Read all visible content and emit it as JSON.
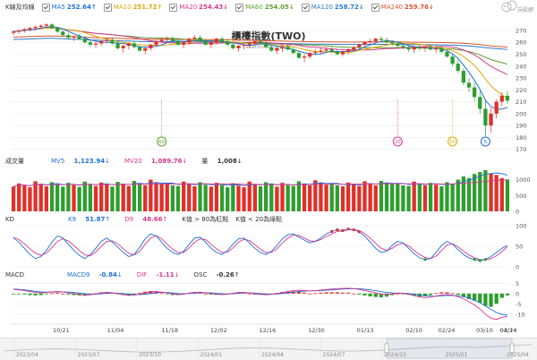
{
  "header": {
    "kline_label": "K線及均線",
    "ma": [
      {
        "name": "MA5",
        "value": "252.64",
        "arrow": "↑",
        "color": "#1e6fd9"
      },
      {
        "name": "MA10",
        "value": "251.72",
        "arrow": "↑",
        "color": "#e0a800"
      },
      {
        "name": "MA20",
        "value": "254.43",
        "arrow": "↓",
        "color": "#d9368b"
      },
      {
        "name": "MA60",
        "value": "254.05",
        "arrow": "↓",
        "color": "#5aa02c"
      },
      {
        "name": "MA120",
        "value": "258.72",
        "arrow": "↓",
        "color": "#2a7ac7"
      },
      {
        "name": "MA240",
        "value": "259.76",
        "arrow": "↓",
        "color": "#d9542b"
      }
    ],
    "logo_text": "玩股網"
  },
  "chart_title": "櫃檯指數(TWO)",
  "watermark": "WantGoo 玩股網",
  "price_axis": {
    "ticks": [
      170,
      180,
      190,
      200,
      210,
      220,
      230,
      240,
      250,
      260,
      270
    ],
    "min": 166,
    "max": 276
  },
  "volume_legend": {
    "label": "成交量",
    "mv5_name": "MV5",
    "mv5": "1,123.94",
    "mv5_arrow": "↓",
    "mv20_name": "MV20",
    "mv20": "1,089.76",
    "mv20_arrow": "↓",
    "qty_name": "量",
    "qty": "1,008",
    "qty_arrow": "↓"
  },
  "volume_axis": {
    "ticks": [
      0,
      500,
      1000
    ],
    "min": 0,
    "max": 1300
  },
  "kd_legend": {
    "label": "KD",
    "k_name": "K9",
    "k": "51.87",
    "k_arrow": "↑",
    "d_name": "D9",
    "d": "48.66",
    "d_arrow": "↑",
    "rule1": "K值 > 80為紅點",
    "rule2": "K值 < 20為綠點"
  },
  "kd_axis": {
    "ticks": [
      0,
      50,
      100
    ],
    "min": 0,
    "max": 100
  },
  "macd_legend": {
    "label": "MACD",
    "macd_name": "MACD9",
    "macd": "-0.84",
    "macd_arrow": "↓",
    "dif_name": "DIF",
    "dif": "-1.11",
    "dif_arrow": "↓",
    "osc_name": "OSC",
    "osc": "-0.26",
    "osc_arrow": "↑"
  },
  "macd_axis": {
    "ticks": [
      5,
      0,
      -5,
      -10
    ]
  },
  "x_dates": [
    "10/21",
    "11/04",
    "11/18",
    "12/02",
    "12/16",
    "12/30",
    "01/13",
    "02/10",
    "02/24",
    "03/10",
    "03/24",
    "04/14"
  ],
  "markers": [
    {
      "label": "60",
      "color": "#5aa02c",
      "after_date": "01/13"
    },
    {
      "label": "20",
      "color": "#d9368b",
      "after_date": "03/24"
    },
    {
      "label": "10",
      "color": "#e0a800",
      "after_date": "03/24"
    },
    {
      "label": "5",
      "color": "#1e6fd9",
      "after_date": "03/24"
    }
  ],
  "navigator_dates": [
    "2023/04",
    "2023/07",
    "2023/10",
    "2024/01",
    "2024/04",
    "2024/07",
    "2024/10",
    "2025/01",
    "2025/04"
  ],
  "chart_data": {
    "type": "candlestick",
    "ohlc": [
      [
        268,
        270,
        266,
        269
      ],
      [
        269,
        271,
        267,
        270
      ],
      [
        270,
        272,
        268,
        271
      ],
      [
        271,
        273,
        269,
        272
      ],
      [
        272,
        274,
        270,
        273
      ],
      [
        273,
        275,
        271,
        274
      ],
      [
        274,
        276,
        272,
        275
      ],
      [
        275,
        276,
        271,
        272
      ],
      [
        272,
        273,
        268,
        269
      ],
      [
        269,
        270,
        265,
        266
      ],
      [
        266,
        268,
        262,
        264
      ],
      [
        264,
        266,
        261,
        265
      ],
      [
        265,
        267,
        262,
        263
      ],
      [
        263,
        265,
        259,
        260
      ],
      [
        260,
        262,
        256,
        258
      ],
      [
        258,
        261,
        255,
        259
      ],
      [
        259,
        262,
        257,
        261
      ],
      [
        261,
        264,
        259,
        262
      ],
      [
        262,
        264,
        258,
        259
      ],
      [
        259,
        261,
        254,
        255
      ],
      [
        255,
        258,
        251,
        257
      ],
      [
        257,
        260,
        254,
        259
      ],
      [
        259,
        261,
        255,
        256
      ],
      [
        256,
        258,
        252,
        253
      ],
      [
        253,
        256,
        250,
        255
      ],
      [
        255,
        259,
        253,
        258
      ],
      [
        258,
        262,
        256,
        261
      ],
      [
        261,
        264,
        259,
        262
      ],
      [
        262,
        265,
        260,
        263
      ],
      [
        263,
        265,
        260,
        261
      ],
      [
        261,
        263,
        257,
        258
      ],
      [
        258,
        261,
        255,
        260
      ],
      [
        260,
        264,
        258,
        263
      ],
      [
        263,
        266,
        261,
        264
      ],
      [
        264,
        266,
        260,
        261
      ],
      [
        261,
        263,
        257,
        258
      ],
      [
        258,
        261,
        255,
        260
      ],
      [
        260,
        264,
        258,
        263
      ],
      [
        263,
        265,
        260,
        261
      ],
      [
        261,
        263,
        257,
        258
      ],
      [
        258,
        260,
        254,
        255
      ],
      [
        255,
        258,
        252,
        257
      ],
      [
        257,
        260,
        254,
        258
      ],
      [
        258,
        261,
        255,
        259
      ],
      [
        259,
        262,
        257,
        261
      ],
      [
        261,
        263,
        258,
        259
      ],
      [
        259,
        261,
        255,
        256
      ],
      [
        256,
        258,
        252,
        253
      ],
      [
        253,
        256,
        250,
        255
      ],
      [
        255,
        258,
        252,
        256
      ],
      [
        256,
        258,
        253,
        254
      ],
      [
        254,
        256,
        250,
        251
      ],
      [
        251,
        253,
        246,
        247
      ],
      [
        247,
        250,
        243,
        248
      ],
      [
        248,
        252,
        246,
        251
      ],
      [
        251,
        254,
        249,
        252
      ],
      [
        252,
        255,
        250,
        253
      ],
      [
        253,
        256,
        251,
        254
      ],
      [
        254,
        256,
        251,
        252
      ],
      [
        252,
        254,
        249,
        250
      ],
      [
        250,
        253,
        248,
        252
      ],
      [
        252,
        255,
        250,
        254
      ],
      [
        254,
        257,
        252,
        256
      ],
      [
        256,
        259,
        254,
        258
      ],
      [
        258,
        261,
        256,
        260
      ],
      [
        260,
        263,
        258,
        261
      ],
      [
        261,
        264,
        259,
        263
      ],
      [
        263,
        265,
        260,
        262
      ],
      [
        262,
        264,
        259,
        260
      ],
      [
        260,
        262,
        257,
        259
      ],
      [
        259,
        261,
        256,
        257
      ],
      [
        257,
        259,
        254,
        256
      ],
      [
        256,
        258,
        252,
        254
      ],
      [
        254,
        257,
        251,
        256
      ],
      [
        256,
        258,
        253,
        255
      ],
      [
        255,
        257,
        252,
        256
      ],
      [
        256,
        258,
        253,
        254
      ],
      [
        254,
        257,
        251,
        255
      ],
      [
        255,
        257,
        251,
        252
      ],
      [
        252,
        254,
        247,
        248
      ],
      [
        248,
        250,
        240,
        242
      ],
      [
        242,
        245,
        234,
        236
      ],
      [
        236,
        238,
        224,
        226
      ],
      [
        226,
        230,
        218,
        222
      ],
      [
        222,
        226,
        210,
        214
      ],
      [
        214,
        219,
        200,
        204
      ],
      [
        204,
        210,
        182,
        190
      ],
      [
        190,
        205,
        184,
        200
      ],
      [
        200,
        212,
        196,
        210
      ],
      [
        210,
        218,
        206,
        215
      ],
      [
        215,
        219,
        208,
        211
      ]
    ],
    "volume": [
      780,
      880,
      820,
      760,
      950,
      870,
      790,
      920,
      850,
      780,
      900,
      830,
      770,
      940,
      860,
      800,
      910,
      840,
      780,
      930,
      870,
      800,
      960,
      880,
      820,
      1000,
      900,
      850,
      880,
      820,
      800,
      940,
      860,
      790,
      920,
      840,
      780,
      900,
      830,
      760,
      890,
      810,
      760,
      940,
      860,
      790,
      920,
      840,
      780,
      900,
      830,
      800,
      950,
      870,
      820,
      980,
      900,
      840,
      880,
      820,
      790,
      910,
      850,
      800,
      950,
      880,
      820,
      960,
      900,
      860,
      880,
      820,
      800,
      940,
      870,
      820,
      900,
      840,
      790,
      920,
      860,
      1000,
      1100,
      1050,
      1180,
      1240,
      1300,
      1200,
      1150,
      1050,
      1008
    ],
    "kd_k": [
      70,
      60,
      45,
      30,
      20,
      25,
      40,
      60,
      75,
      70,
      55,
      40,
      28,
      20,
      30,
      45,
      62,
      70,
      60,
      48,
      35,
      25,
      30,
      48,
      68,
      80,
      75,
      60,
      45,
      35,
      30,
      38,
      55,
      70,
      72,
      60,
      45,
      35,
      30,
      40,
      55,
      68,
      70,
      58,
      45,
      35,
      30,
      38,
      52,
      68,
      78,
      80,
      72,
      65,
      58,
      62,
      70,
      80,
      86,
      90,
      88,
      92,
      90,
      85,
      75,
      60,
      45,
      35,
      38,
      52,
      62,
      58,
      45,
      32,
      22,
      18,
      20,
      35,
      52,
      62,
      55,
      42,
      30,
      22,
      18,
      15,
      18,
      25,
      35,
      45,
      52
    ],
    "kd_d": [
      72,
      66,
      56,
      44,
      33,
      28,
      33,
      47,
      62,
      68,
      63,
      52,
      40,
      29,
      27,
      36,
      50,
      62,
      63,
      56,
      44,
      33,
      29,
      38,
      55,
      70,
      76,
      68,
      55,
      43,
      35,
      35,
      46,
      60,
      68,
      66,
      55,
      44,
      35,
      36,
      46,
      60,
      67,
      64,
      54,
      43,
      35,
      35,
      44,
      58,
      70,
      77,
      76,
      70,
      63,
      62,
      66,
      74,
      80,
      86,
      87,
      90,
      90,
      88,
      81,
      70,
      57,
      45,
      40,
      45,
      54,
      57,
      51,
      40,
      30,
      23,
      20,
      26,
      40,
      53,
      56,
      49,
      38,
      29,
      22,
      18,
      17,
      20,
      27,
      37,
      49
    ],
    "macd_dif": [
      2,
      1.8,
      1.5,
      1,
      0.5,
      0.3,
      0.5,
      0.8,
      1,
      0.8,
      0.4,
      0,
      -0.4,
      -0.8,
      -0.6,
      -0.2,
      0.3,
      0.6,
      0.4,
      0,
      -0.5,
      -0.9,
      -0.8,
      -0.3,
      0.3,
      0.8,
      1,
      0.7,
      0.3,
      -0.2,
      -0.5,
      -0.3,
      0.2,
      0.6,
      0.7,
      0.4,
      0,
      -0.3,
      -0.5,
      -0.3,
      0.1,
      0.5,
      0.6,
      0.3,
      -0.1,
      -0.4,
      -0.6,
      -0.4,
      0,
      0.5,
      1,
      1.4,
      1.6,
      1.5,
      1.3,
      1.4,
      1.7,
      2,
      2.2,
      2.4,
      2.5,
      2.6,
      2.4,
      2,
      1.5,
      0.9,
      0.3,
      -0.3,
      -0.5,
      -0.2,
      0.2,
      0.1,
      -0.4,
      -1,
      -1.6,
      -2,
      -1.8,
      -1.2,
      -0.7,
      -0.5,
      -0.8,
      -1.5,
      -2.5,
      -4,
      -5.5,
      -7.5,
      -10,
      -12,
      -12.5,
      -11.5,
      -11.1
    ],
    "macd_signal": [
      2.2,
      2,
      1.8,
      1.5,
      1.1,
      0.8,
      0.7,
      0.7,
      0.8,
      0.8,
      0.7,
      0.5,
      0.2,
      -0.1,
      -0.3,
      -0.3,
      -0.1,
      0.1,
      0.2,
      0.2,
      0,
      -0.3,
      -0.5,
      -0.5,
      -0.3,
      0,
      0.4,
      0.6,
      0.5,
      0.3,
      0,
      -0.1,
      0,
      0.2,
      0.4,
      0.4,
      0.3,
      0.1,
      -0.1,
      -0.2,
      -0.1,
      0.1,
      0.3,
      0.3,
      0.2,
      0,
      -0.2,
      -0.3,
      -0.2,
      0,
      0.4,
      0.7,
      1,
      1.2,
      1.3,
      1.3,
      1.4,
      1.6,
      1.8,
      2,
      2.2,
      2.3,
      2.4,
      2.3,
      2.1,
      1.8,
      1.4,
      0.9,
      0.5,
      0.3,
      0.2,
      0.2,
      0,
      -0.3,
      -0.7,
      -1.1,
      -1.3,
      -1.3,
      -1.1,
      -0.9,
      -0.9,
      -1.1,
      -1.5,
      -2.2,
      -3.2,
      -4.5,
      -6,
      -7.7,
      -9.2,
      -10.1,
      -10.5
    ]
  }
}
